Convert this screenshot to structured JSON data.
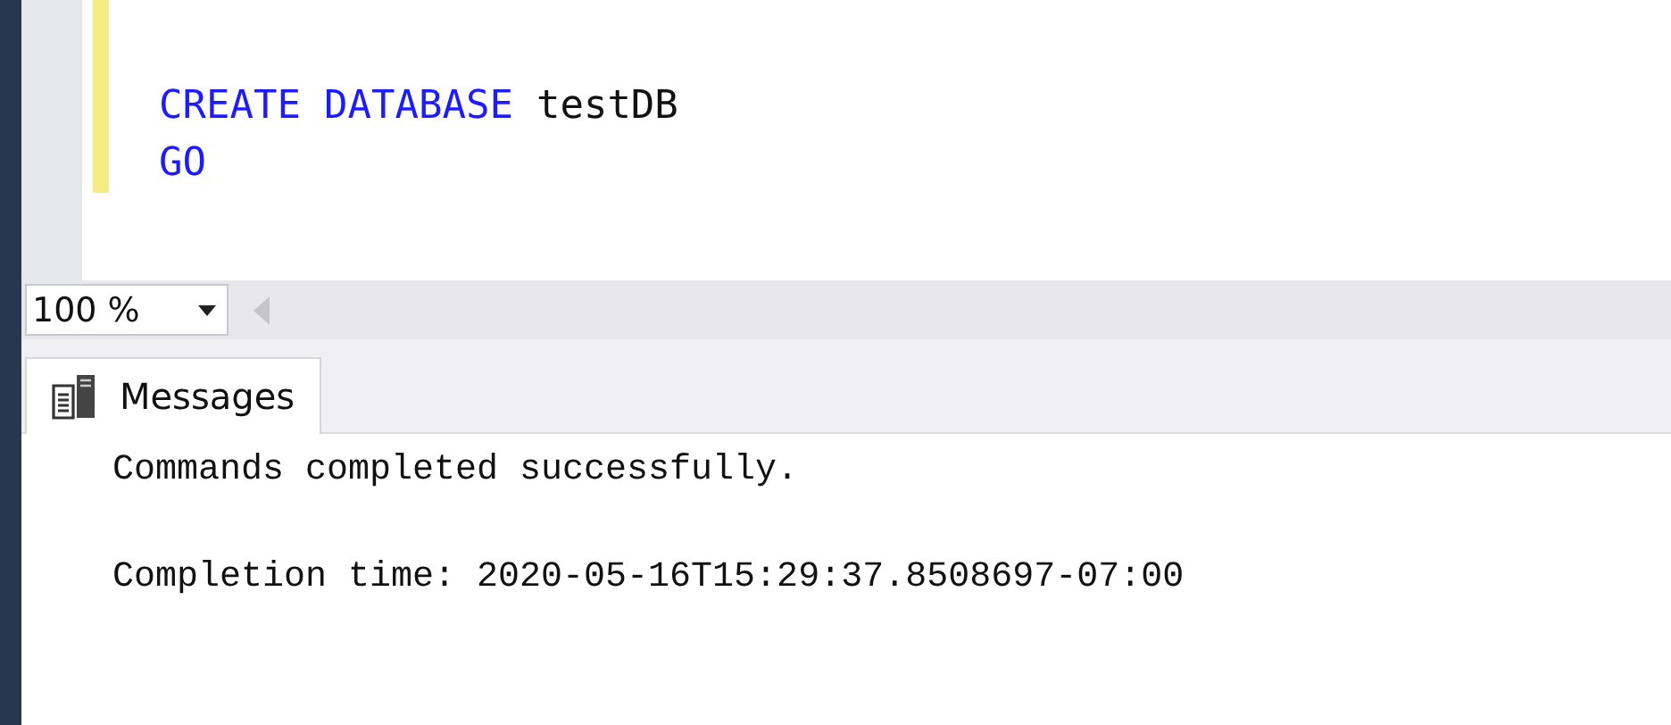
{
  "editor": {
    "lines": [
      {
        "tokens": [
          {
            "kind": "keyword",
            "text": "CREATE"
          },
          {
            "kind": "keyword",
            "text": "DATABASE"
          },
          {
            "kind": "plain",
            "text": "testDB"
          }
        ]
      },
      {
        "tokens": [
          {
            "kind": "keyword",
            "text": "GO"
          }
        ]
      }
    ]
  },
  "zoom": {
    "value": "100 %"
  },
  "tabs": [
    {
      "label": "Messages",
      "selected": true
    }
  ],
  "messages": [
    "Commands completed successfully.",
    "Completion time: 2020-05-16T15:29:37.8508697-07:00"
  ]
}
